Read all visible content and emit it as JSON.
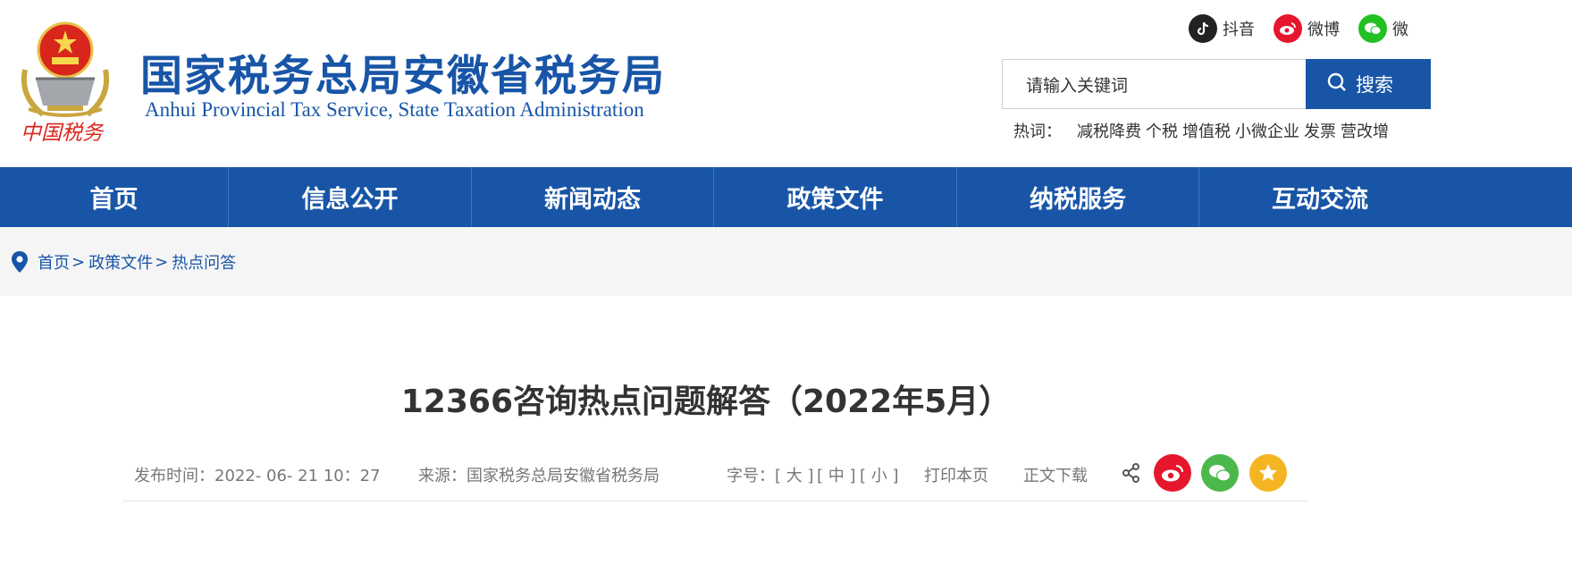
{
  "header": {
    "emblem_text": "中国税务",
    "title": "国家税务总局安徽省税务局",
    "subtitle": "Anhui Provincial Tax Service, State Taxation Administration",
    "social": [
      {
        "label": "抖音",
        "icon": "douyin-icon",
        "color": "#222222"
      },
      {
        "label": "微博",
        "icon": "weibo-icon",
        "color": "#e6162d"
      },
      {
        "label": "微",
        "icon": "wechat-icon",
        "color": "#22c022"
      }
    ],
    "search": {
      "placeholder": "请输入关键词",
      "button_label": "搜索"
    },
    "hotwords": {
      "label": "热词：",
      "items": [
        "减税降费",
        "个税",
        "增值税",
        "小微企业",
        "发票",
        "营改增"
      ]
    }
  },
  "nav": {
    "items": [
      "首页",
      "信息公开",
      "新闻动态",
      "政策文件",
      "纳税服务",
      "互动交流"
    ],
    "background": "#1855a7"
  },
  "breadcrumb": {
    "items": [
      "首页",
      "政策文件",
      "热点问答"
    ],
    "separator": ">"
  },
  "article": {
    "title": "12366咨询热点问题解答（2022年5月）",
    "meta": {
      "publish": "发布时间：2022- 06- 21   10：27",
      "source": "来源：国家税务总局安徽省税务局",
      "font_label": "字号：",
      "font_large": "[ 大 ]",
      "font_medium": "[ 中 ]",
      "font_small": "[ 小 ]",
      "print": "打印本页",
      "download": "正文下载"
    }
  },
  "share": {
    "icons": [
      {
        "icon": "share-icon"
      },
      {
        "icon": "weibo-share-icon",
        "color": "#e6162d"
      },
      {
        "icon": "wechat-share-icon",
        "color": "#4cb84c"
      },
      {
        "icon": "favorite-star-icon",
        "color": "#f5b522"
      }
    ]
  }
}
